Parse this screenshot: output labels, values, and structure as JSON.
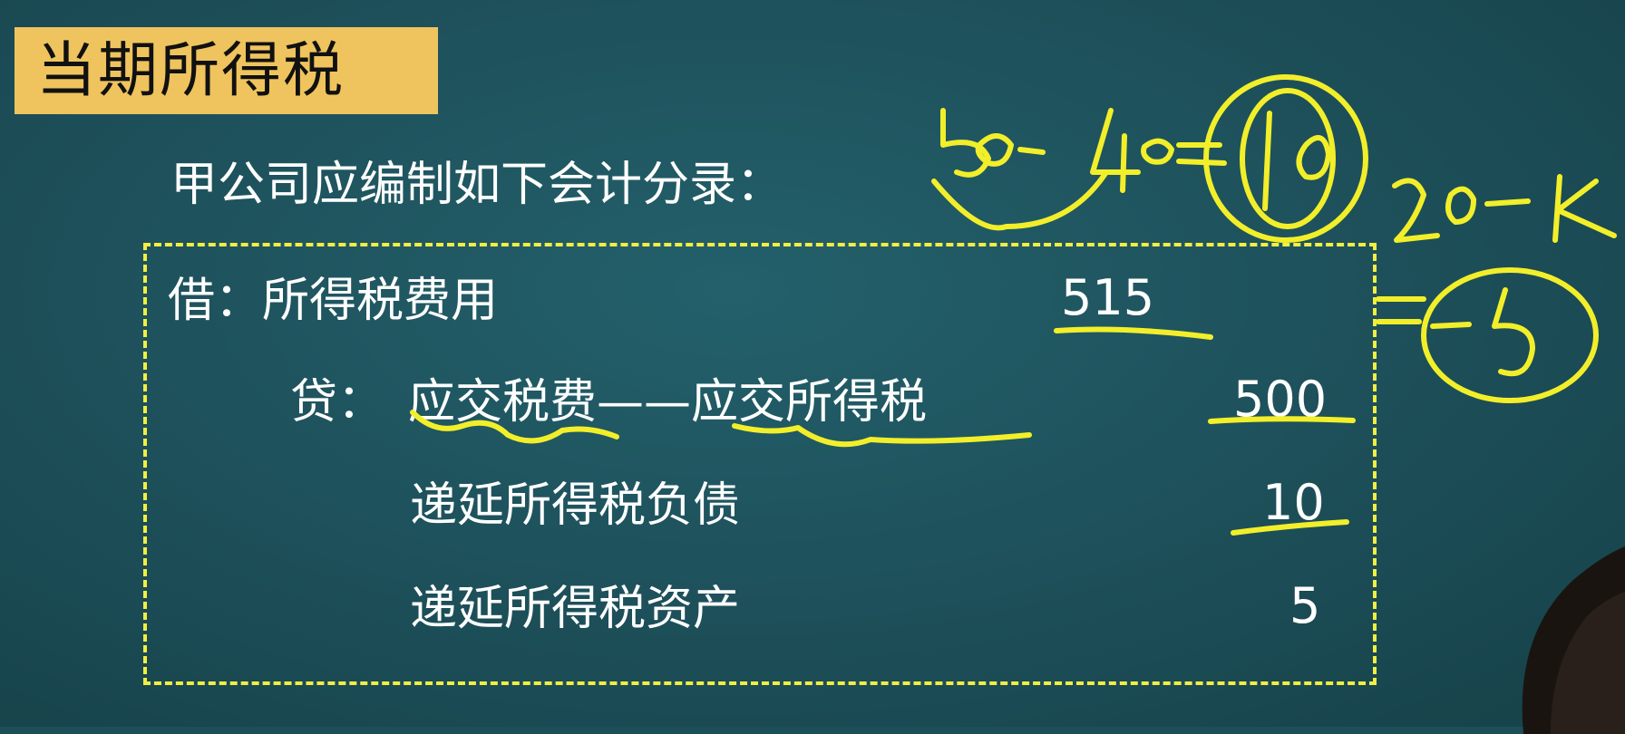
{
  "title": "当期所得税",
  "intro": "甲公司应编制如下会计分录：",
  "debit": {
    "label": "借：所得税费用",
    "amount": "515"
  },
  "credit": {
    "prefix": "贷：",
    "lines": [
      {
        "label": "应交税费——应交所得税",
        "amount": "500"
      },
      {
        "label": "递延所得税负债",
        "amount": "10"
      },
      {
        "label": "递延所得税资产",
        "amount": "5"
      }
    ]
  },
  "colors": {
    "background": "#1d4f59",
    "title_bar": "#efc45e",
    "dashed_border": "#f2ee42",
    "ink": "#f2ef2a",
    "text": "#ffffff"
  }
}
